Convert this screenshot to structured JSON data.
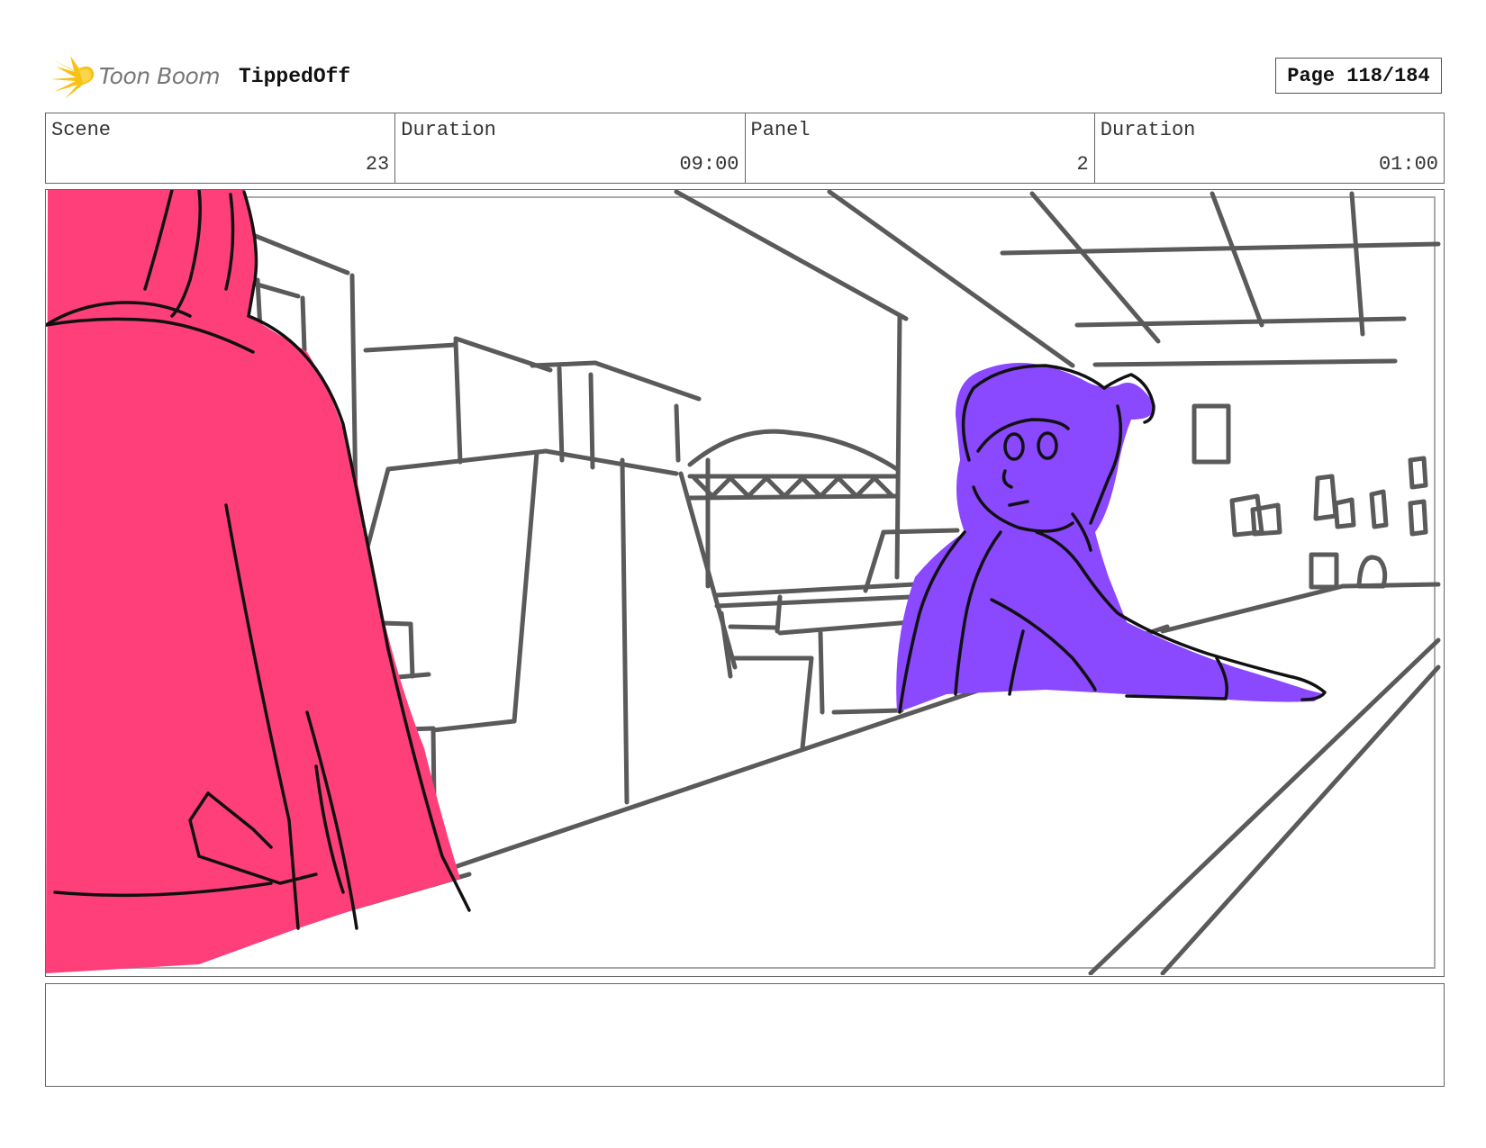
{
  "header": {
    "logo_text": "Toon Boom",
    "project_title": "TippedOff",
    "page_label": "Page 118/184"
  },
  "info": {
    "scene_label": "Scene",
    "scene_value": "23",
    "scene_duration_label": "Duration",
    "scene_duration_value": "09:00",
    "panel_label": "Panel",
    "panel_value": "2",
    "panel_duration_label": "Duration",
    "panel_duration_value": "01:00"
  },
  "colors": {
    "pink_character": "#ff3f7a",
    "purple_character": "#8a48ff",
    "sketch_line": "#5a5a5a",
    "logo_yellow": "#f7c215"
  },
  "notes": {
    "text": ""
  }
}
